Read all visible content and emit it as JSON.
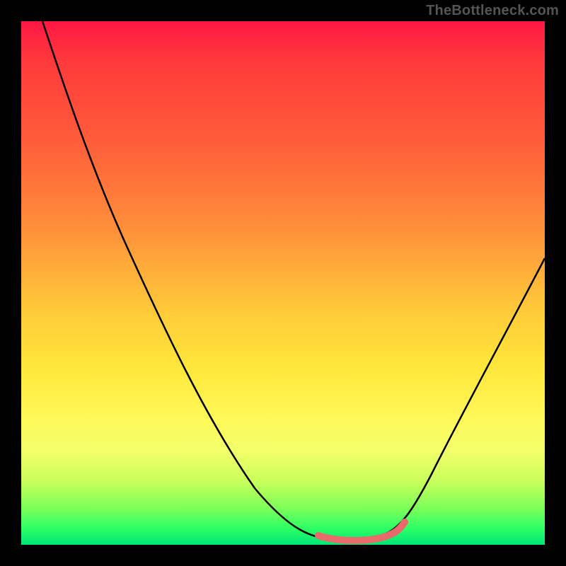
{
  "watermark": "TheBottleneck.com",
  "colors": {
    "background": "#000000",
    "watermark": "#555555",
    "curve_stroke": "#000000",
    "pink_segment": "#e86a6a",
    "gradient_stops": [
      "#ff1744",
      "#ff3b3b",
      "#ff5a3a",
      "#ff8a3a",
      "#ffc93a",
      "#ffe63a",
      "#fff95a",
      "#f3ff6a",
      "#c8ff5a",
      "#7dff5a",
      "#2bff66",
      "#00e676"
    ]
  },
  "chart_data": {
    "type": "line",
    "title": "",
    "xlabel": "",
    "ylabel": "",
    "xlim": [
      0,
      100
    ],
    "ylim": [
      0,
      100
    ],
    "grid": false,
    "legend": false,
    "series": [
      {
        "name": "curve",
        "x": [
          4,
          10,
          20,
          30,
          40,
          50,
          55,
          58,
          60,
          63,
          66,
          69,
          72,
          76,
          82,
          90,
          100
        ],
        "y": [
          100,
          88,
          70,
          52,
          34,
          16,
          8,
          4,
          2,
          1,
          1,
          1,
          2,
          5,
          16,
          34,
          55
        ]
      }
    ],
    "annotations": [
      {
        "name": "pink-flat-segment",
        "x_range": [
          58,
          73
        ],
        "y": 1.5,
        "color": "#e86a6a"
      }
    ]
  }
}
